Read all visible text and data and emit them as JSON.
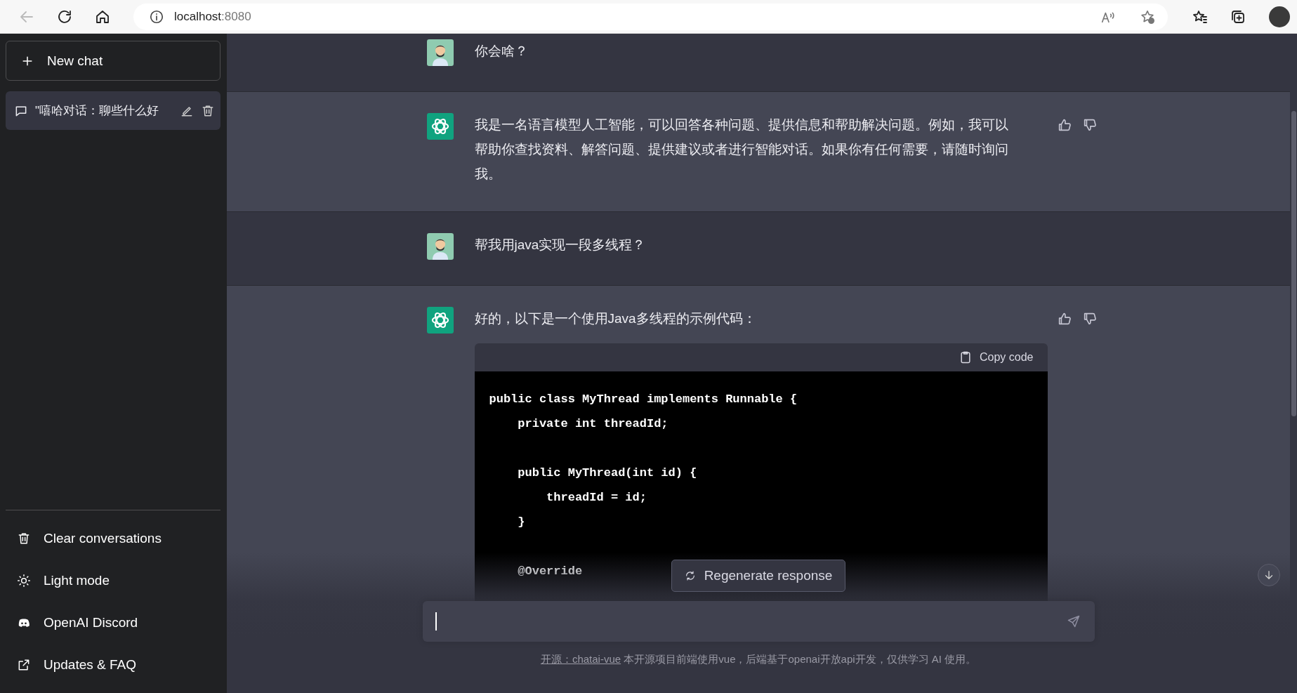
{
  "browser": {
    "host": "localhost",
    "port": ":8080",
    "back_disabled": true
  },
  "sidebar": {
    "new_chat": "New chat",
    "conversations": [
      {
        "title": "\"嘻哈对话：聊些什么好",
        "selected": true
      }
    ],
    "footer_items": [
      {
        "kind": "trash",
        "label": "Clear conversations"
      },
      {
        "kind": "sun",
        "label": "Light mode"
      },
      {
        "kind": "chat-bubble",
        "label": "OpenAI Discord"
      },
      {
        "kind": "external",
        "label": "Updates & FAQ"
      }
    ]
  },
  "messages": [
    {
      "kind": "user",
      "text": "你会啥？"
    },
    {
      "kind": "assistant",
      "text": "我是一名语言模型人工智能，可以回答各种问题、提供信息和帮助解决问题。例如，我可以帮助你查找资料、解答问题、提供建议或者进行智能对话。如果你有任何需要，请随时询问我。"
    },
    {
      "kind": "user",
      "text": "帮我用java实现一段多线程？"
    },
    {
      "kind": "assistant",
      "text": "好的，以下是一个使用Java多线程的示例代码：",
      "code": {
        "copy_label": "Copy code",
        "lines": [
          {
            "kind": "code",
            "text": "public class MyThread implements Runnable {"
          },
          {
            "kind": "code",
            "text": "    private int threadId;"
          },
          {
            "kind": "blank"
          },
          {
            "kind": "code",
            "text": "    public MyThread(int id) {"
          },
          {
            "kind": "code",
            "text": "        threadId = id;"
          },
          {
            "kind": "code",
            "text": "    }"
          },
          {
            "kind": "blank"
          },
          {
            "kind": "code",
            "text": "    @Override"
          }
        ]
      }
    }
  ],
  "regenerate": "Regenerate response",
  "footer": {
    "link": "开源：chatai-vue",
    "text": "本开源项目前端使用vue，后端基于openai开放api开发，仅供学习 AI 使用。"
  }
}
